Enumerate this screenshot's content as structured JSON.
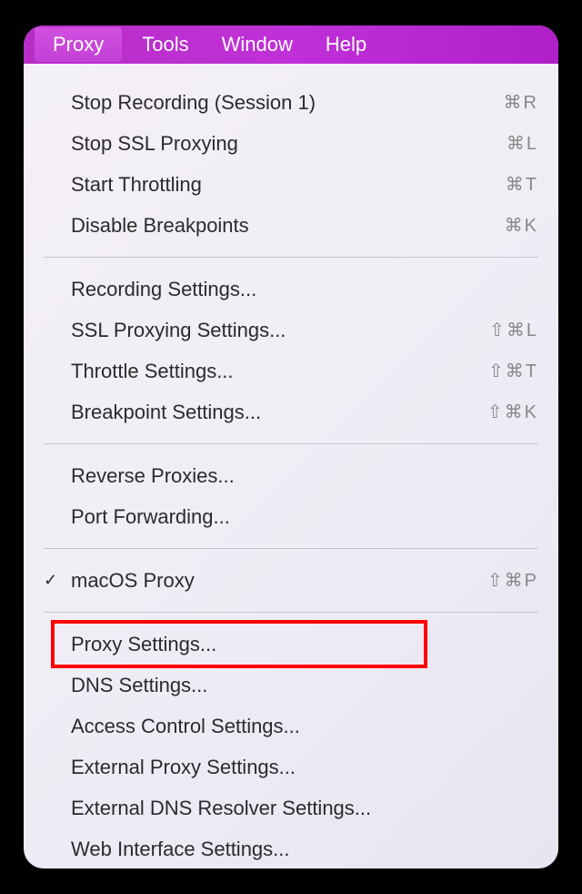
{
  "menubar": {
    "items": [
      {
        "label": "Proxy",
        "active": true
      },
      {
        "label": "Tools",
        "active": false
      },
      {
        "label": "Window",
        "active": false
      },
      {
        "label": "Help",
        "active": false
      }
    ]
  },
  "menu": {
    "section1": [
      {
        "label": "Stop Recording (Session 1)",
        "shortcut": "⌘R"
      },
      {
        "label": "Stop SSL Proxying",
        "shortcut": "⌘L"
      },
      {
        "label": "Start Throttling",
        "shortcut": "⌘T"
      },
      {
        "label": "Disable Breakpoints",
        "shortcut": "⌘K"
      }
    ],
    "section2": [
      {
        "label": "Recording Settings..."
      },
      {
        "label": "SSL Proxying Settings...",
        "shortcut": "⇧⌘L"
      },
      {
        "label": "Throttle Settings...",
        "shortcut": "⇧⌘T"
      },
      {
        "label": "Breakpoint Settings...",
        "shortcut": "⇧⌘K"
      }
    ],
    "section3": [
      {
        "label": "Reverse Proxies..."
      },
      {
        "label": "Port Forwarding..."
      }
    ],
    "section4": [
      {
        "label": "macOS Proxy",
        "shortcut": "⇧⌘P",
        "checked": true
      }
    ],
    "section5": [
      {
        "label": "Proxy Settings...",
        "highlighted": true
      },
      {
        "label": "DNS Settings..."
      },
      {
        "label": "Access Control Settings..."
      },
      {
        "label": "External Proxy Settings..."
      },
      {
        "label": "External DNS Resolver Settings..."
      },
      {
        "label": "Web Interface Settings..."
      }
    ]
  }
}
